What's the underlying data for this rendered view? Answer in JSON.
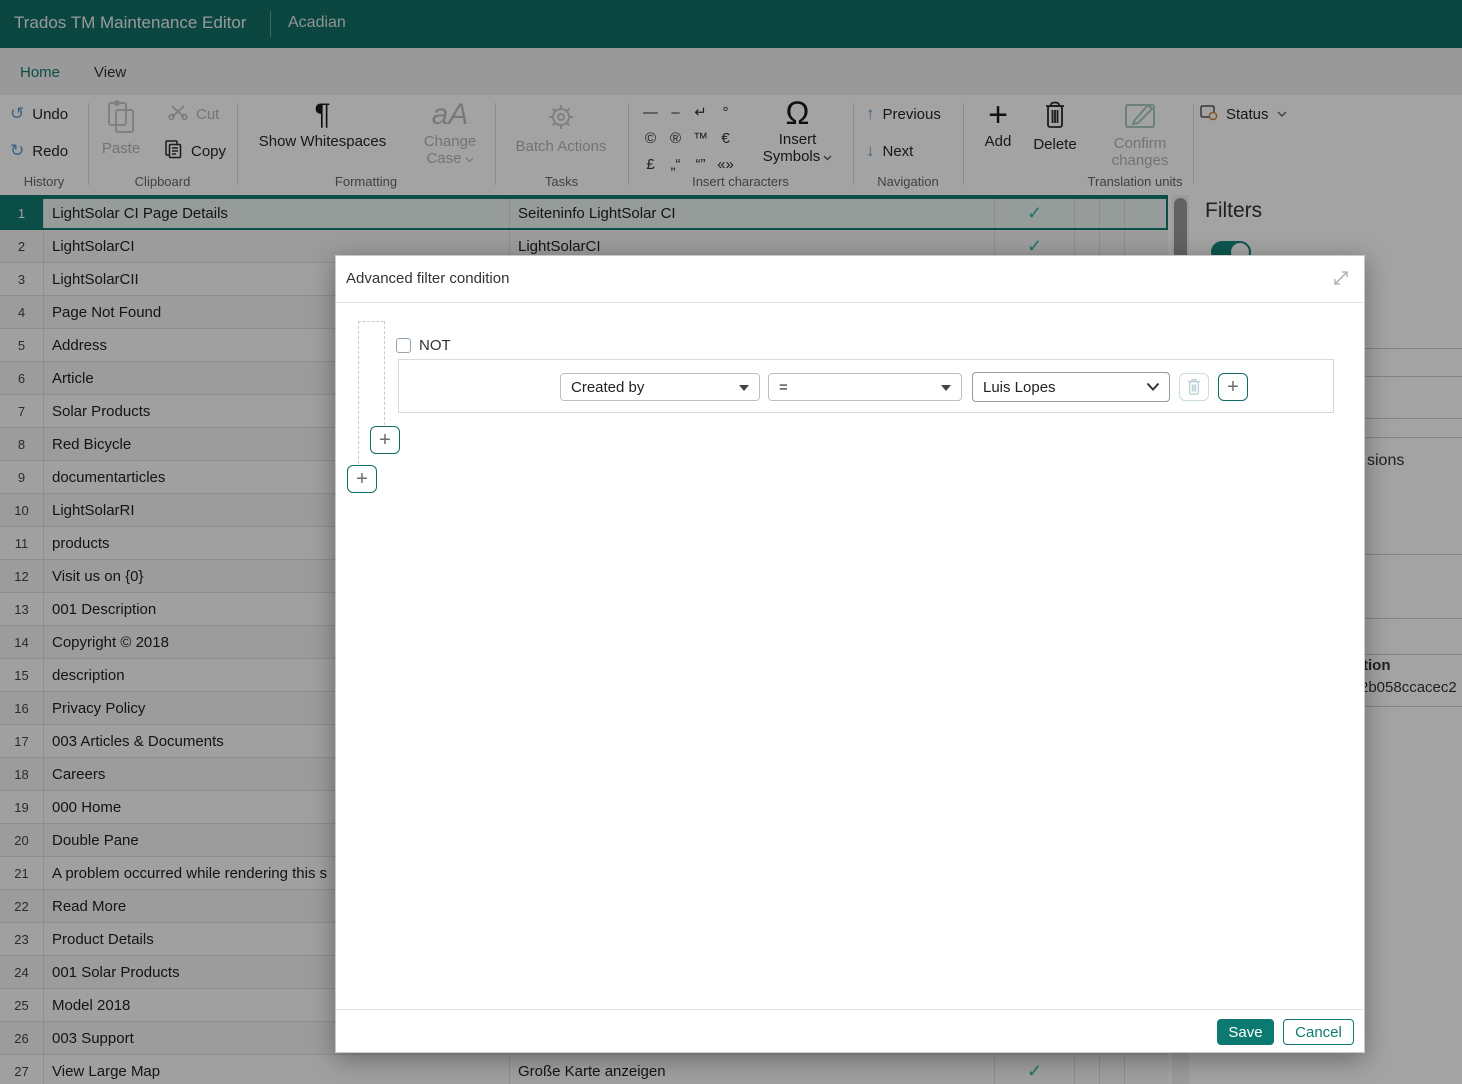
{
  "topbar": {
    "app_title": "Trados TM Maintenance Editor",
    "tm_name": "Acadian"
  },
  "tabs": {
    "home": "Home",
    "view": "View"
  },
  "toolbar": {
    "history": {
      "label": "History",
      "undo": "Undo",
      "redo": "Redo"
    },
    "clipboard": {
      "label": "Clipboard",
      "paste": "Paste",
      "cut": "Cut",
      "copy": "Copy"
    },
    "formatting": {
      "label": "Formatting",
      "show_whitespaces": "Show Whitespaces",
      "change_case_line1": "Change",
      "change_case_line2": "Case"
    },
    "tasks": {
      "label": "Tasks",
      "batch_actions": "Batch Actions"
    },
    "insert_chars": {
      "label": "Insert characters",
      "chars": [
        "—",
        "–",
        "↵",
        "°",
        "©",
        "®",
        "™",
        "€",
        "£",
        "„“",
        "“”",
        "«»"
      ],
      "insert_symbols_line1": "Insert",
      "insert_symbols_line2": "Symbols"
    },
    "navigation": {
      "label": "Navigation",
      "previous": "Previous",
      "next": "Next"
    },
    "translation_units": {
      "label": "Translation units",
      "add": "Add",
      "delete": "Delete",
      "confirm_line1": "Confirm",
      "confirm_line2": "changes"
    },
    "status": {
      "label": "Status"
    }
  },
  "icons": {
    "undo": "↺",
    "redo": "↻",
    "pilcrow": "¶",
    "change_case": "aA",
    "omega": "Ω",
    "up_arrow": "↑",
    "down_arrow": "↓",
    "plus": "+",
    "check": "✓"
  },
  "grid": {
    "rows": [
      {
        "num": "1",
        "source": "LightSolar CI Page Details",
        "target": "Seiteninfo LightSolar CI",
        "confirmed": true,
        "selected": true
      },
      {
        "num": "2",
        "source": "LightSolarCI",
        "target": "LightSolarCI",
        "confirmed": true,
        "selected": false
      },
      {
        "num": "3",
        "source": "LightSolarCII",
        "target": "",
        "confirmed": false,
        "selected": false
      },
      {
        "num": "4",
        "source": "Page Not Found",
        "target": "",
        "confirmed": false,
        "selected": false
      },
      {
        "num": "5",
        "source": "Address",
        "target": "",
        "confirmed": false,
        "selected": false
      },
      {
        "num": "6",
        "source": "Article",
        "target": "",
        "confirmed": false,
        "selected": false
      },
      {
        "num": "7",
        "source": "Solar Products",
        "target": "",
        "confirmed": false,
        "selected": false
      },
      {
        "num": "8",
        "source": "Red Bicycle",
        "target": "",
        "confirmed": false,
        "selected": false
      },
      {
        "num": "9",
        "source": "documentarticles",
        "target": "",
        "confirmed": false,
        "selected": false
      },
      {
        "num": "10",
        "source": "LightSolarRI",
        "target": "",
        "confirmed": false,
        "selected": false
      },
      {
        "num": "11",
        "source": "products",
        "target": "",
        "confirmed": false,
        "selected": false
      },
      {
        "num": "12",
        "source": "Visit us on {0}",
        "target": "",
        "confirmed": false,
        "selected": false
      },
      {
        "num": "13",
        "source": "001 Description",
        "target": "",
        "confirmed": false,
        "selected": false
      },
      {
        "num": "14",
        "source": "Copyright © 2018",
        "target": "",
        "confirmed": false,
        "selected": false
      },
      {
        "num": "15",
        "source": "description",
        "target": "",
        "confirmed": false,
        "selected": false
      },
      {
        "num": "16",
        "source": "Privacy Policy",
        "target": "",
        "confirmed": false,
        "selected": false
      },
      {
        "num": "17",
        "source": "003 Articles & Documents",
        "target": "",
        "confirmed": false,
        "selected": false
      },
      {
        "num": "18",
        "source": "Careers",
        "target": "",
        "confirmed": false,
        "selected": false
      },
      {
        "num": "19",
        "source": "000 Home",
        "target": "",
        "confirmed": false,
        "selected": false
      },
      {
        "num": "20",
        "source": "Double Pane",
        "target": "",
        "confirmed": false,
        "selected": false
      },
      {
        "num": "21",
        "source": "A problem occurred while rendering this s",
        "target": "",
        "confirmed": false,
        "selected": false
      },
      {
        "num": "22",
        "source": "Read More",
        "target": "",
        "confirmed": false,
        "selected": false
      },
      {
        "num": "23",
        "source": "Product Details",
        "target": "",
        "confirmed": false,
        "selected": false
      },
      {
        "num": "24",
        "source": "001 Solar Products",
        "target": "",
        "confirmed": false,
        "selected": false
      },
      {
        "num": "25",
        "source": "Model 2018",
        "target": "",
        "confirmed": false,
        "selected": false
      },
      {
        "num": "26",
        "source": "003 Support",
        "target": "",
        "confirmed": false,
        "selected": false
      },
      {
        "num": "27",
        "source": "View Large Map",
        "target": "Große Karte anzeigen",
        "confirmed": true,
        "selected": false
      }
    ]
  },
  "filters_panel": {
    "title": "Filters",
    "toggle_on": true,
    "clipped_fragments": {
      "fragment1": "sions",
      "fragment2": "tion",
      "fragment3": "2b058ccacec2"
    }
  },
  "modal": {
    "title": "Advanced filter condition",
    "not_label": "NOT",
    "condition": {
      "field": "Created by",
      "operator": "=",
      "value": "Luis Lopes"
    },
    "save": "Save",
    "cancel": "Cancel"
  },
  "colors": {
    "topbar_teal": "#136e66",
    "accent_teal": "#127a6e",
    "check_teal": "#2eb7a0",
    "arrow_blue": "#5b9bd5",
    "save_teal": "#0c7a70",
    "status_badge_orange": "#c9803c"
  }
}
